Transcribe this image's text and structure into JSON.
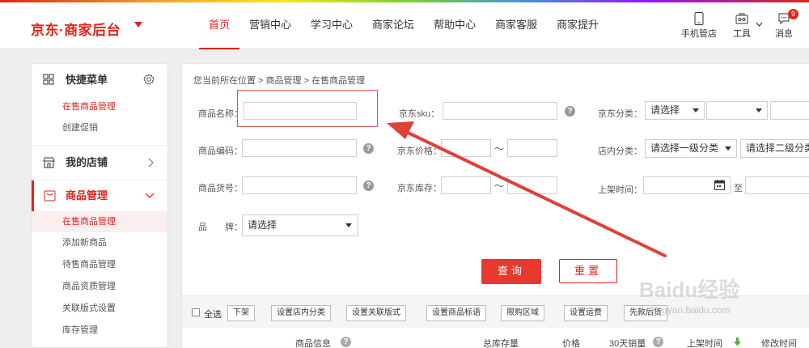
{
  "header": {
    "logo": "京东·商家后台",
    "nav": [
      "首页",
      "营销中心",
      "学习中心",
      "商家论坛",
      "帮助中心",
      "商家客服",
      "商家提升"
    ],
    "tools": [
      {
        "icon": "phone-icon",
        "label": "手机管店"
      },
      {
        "icon": "toolbox-icon",
        "label": "工具"
      },
      {
        "icon": "chat-icon",
        "label": "消息",
        "badge": "9"
      }
    ]
  },
  "sidebar": {
    "quick_menu": "快捷菜单",
    "quick_items": [
      "在售商品管理",
      "创建促销"
    ],
    "store": "我的店铺",
    "goods": "商品管理",
    "goods_items": [
      "在售商品管理",
      "添加新商品",
      "待售商品管理",
      "商品资质管理",
      "关联版式设置",
      "库存管理"
    ]
  },
  "main": {
    "breadcrumb": "您当前所在位置 > 商品管理 > 在售商品管理",
    "labels": {
      "name": "商品名称：",
      "sku": "京东sku：",
      "category": "京东分类：",
      "code": "商品编码：",
      "price": "京东价格：",
      "store_category": "店内分类：",
      "goods_no": "商品货号：",
      "stock": "京东库存：",
      "listing_time": "上架时间：",
      "brand": "品　　牌："
    },
    "tilde": "～",
    "to": "至",
    "selects": {
      "category": "请选择",
      "store_cat_1": "请选择一级分类",
      "store_cat_2": "请选择二级分类",
      "brand": "请选择"
    },
    "buttons": {
      "query": "查询",
      "reset": "重置"
    },
    "toolbar": {
      "select_all": "全选",
      "actions": [
        "下架",
        "设置店内分类",
        "设置关联版式",
        "设置商品标语",
        "限购区域",
        "设置运费",
        "先款后货"
      ]
    },
    "columns": [
      "商品信息",
      "总库存量",
      "价格",
      "30天销量",
      "上架时间",
      "修改时间"
    ]
  },
  "watermark": {
    "brand": "Baidu经验",
    "url": "jingyan.baidu.com"
  },
  "colors": {
    "accent": "#e2231a",
    "button": "#e8392f",
    "arrow": "#e0403a"
  }
}
